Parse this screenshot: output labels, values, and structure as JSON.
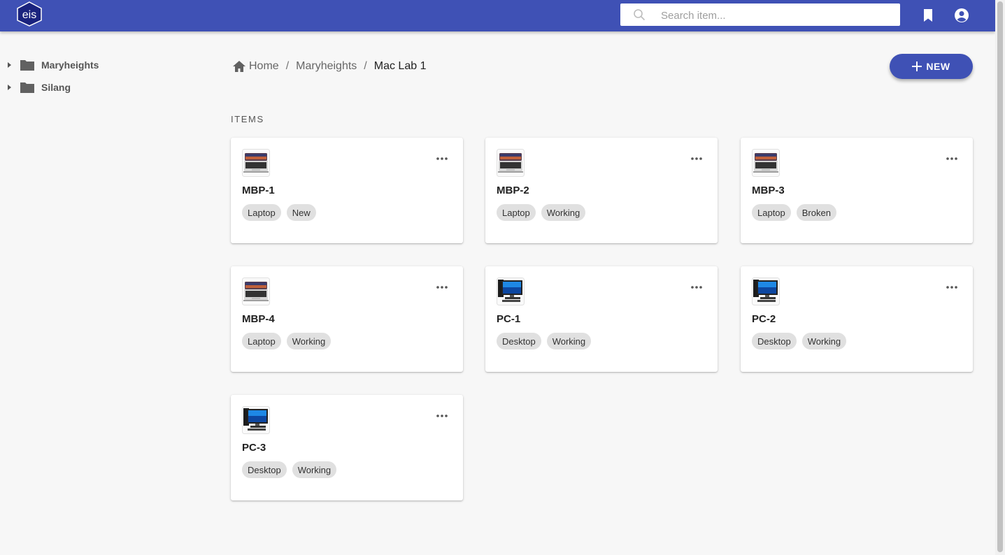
{
  "app": {
    "logo_text": "eis",
    "search_placeholder": "Search item...",
    "brand_color": "#3f51b5"
  },
  "sidebar": {
    "items": [
      {
        "label": "Maryheights",
        "icon": "folder-icon"
      },
      {
        "label": "Silang",
        "icon": "folder-icon"
      }
    ]
  },
  "breadcrumb": {
    "home": "Home",
    "parent": "Maryheights",
    "separator": "/",
    "current": "Mac Lab 1"
  },
  "new_button": {
    "label": "NEW",
    "icon": "plus-icon"
  },
  "section_label": "ITEMS",
  "items": [
    {
      "name": "MBP-1",
      "icon": "laptop-icon",
      "tags": [
        "Laptop",
        "New"
      ]
    },
    {
      "name": "MBP-2",
      "icon": "laptop-icon",
      "tags": [
        "Laptop",
        "Working"
      ]
    },
    {
      "name": "MBP-3",
      "icon": "laptop-icon",
      "tags": [
        "Laptop",
        "Broken"
      ]
    },
    {
      "name": "MBP-4",
      "icon": "laptop-icon",
      "tags": [
        "Laptop",
        "Working"
      ]
    },
    {
      "name": "PC-1",
      "icon": "desktop-icon",
      "tags": [
        "Desktop",
        "Working"
      ]
    },
    {
      "name": "PC-2",
      "icon": "desktop-icon",
      "tags": [
        "Desktop",
        "Working"
      ]
    },
    {
      "name": "PC-3",
      "icon": "desktop-icon",
      "tags": [
        "Desktop",
        "Working"
      ]
    }
  ]
}
